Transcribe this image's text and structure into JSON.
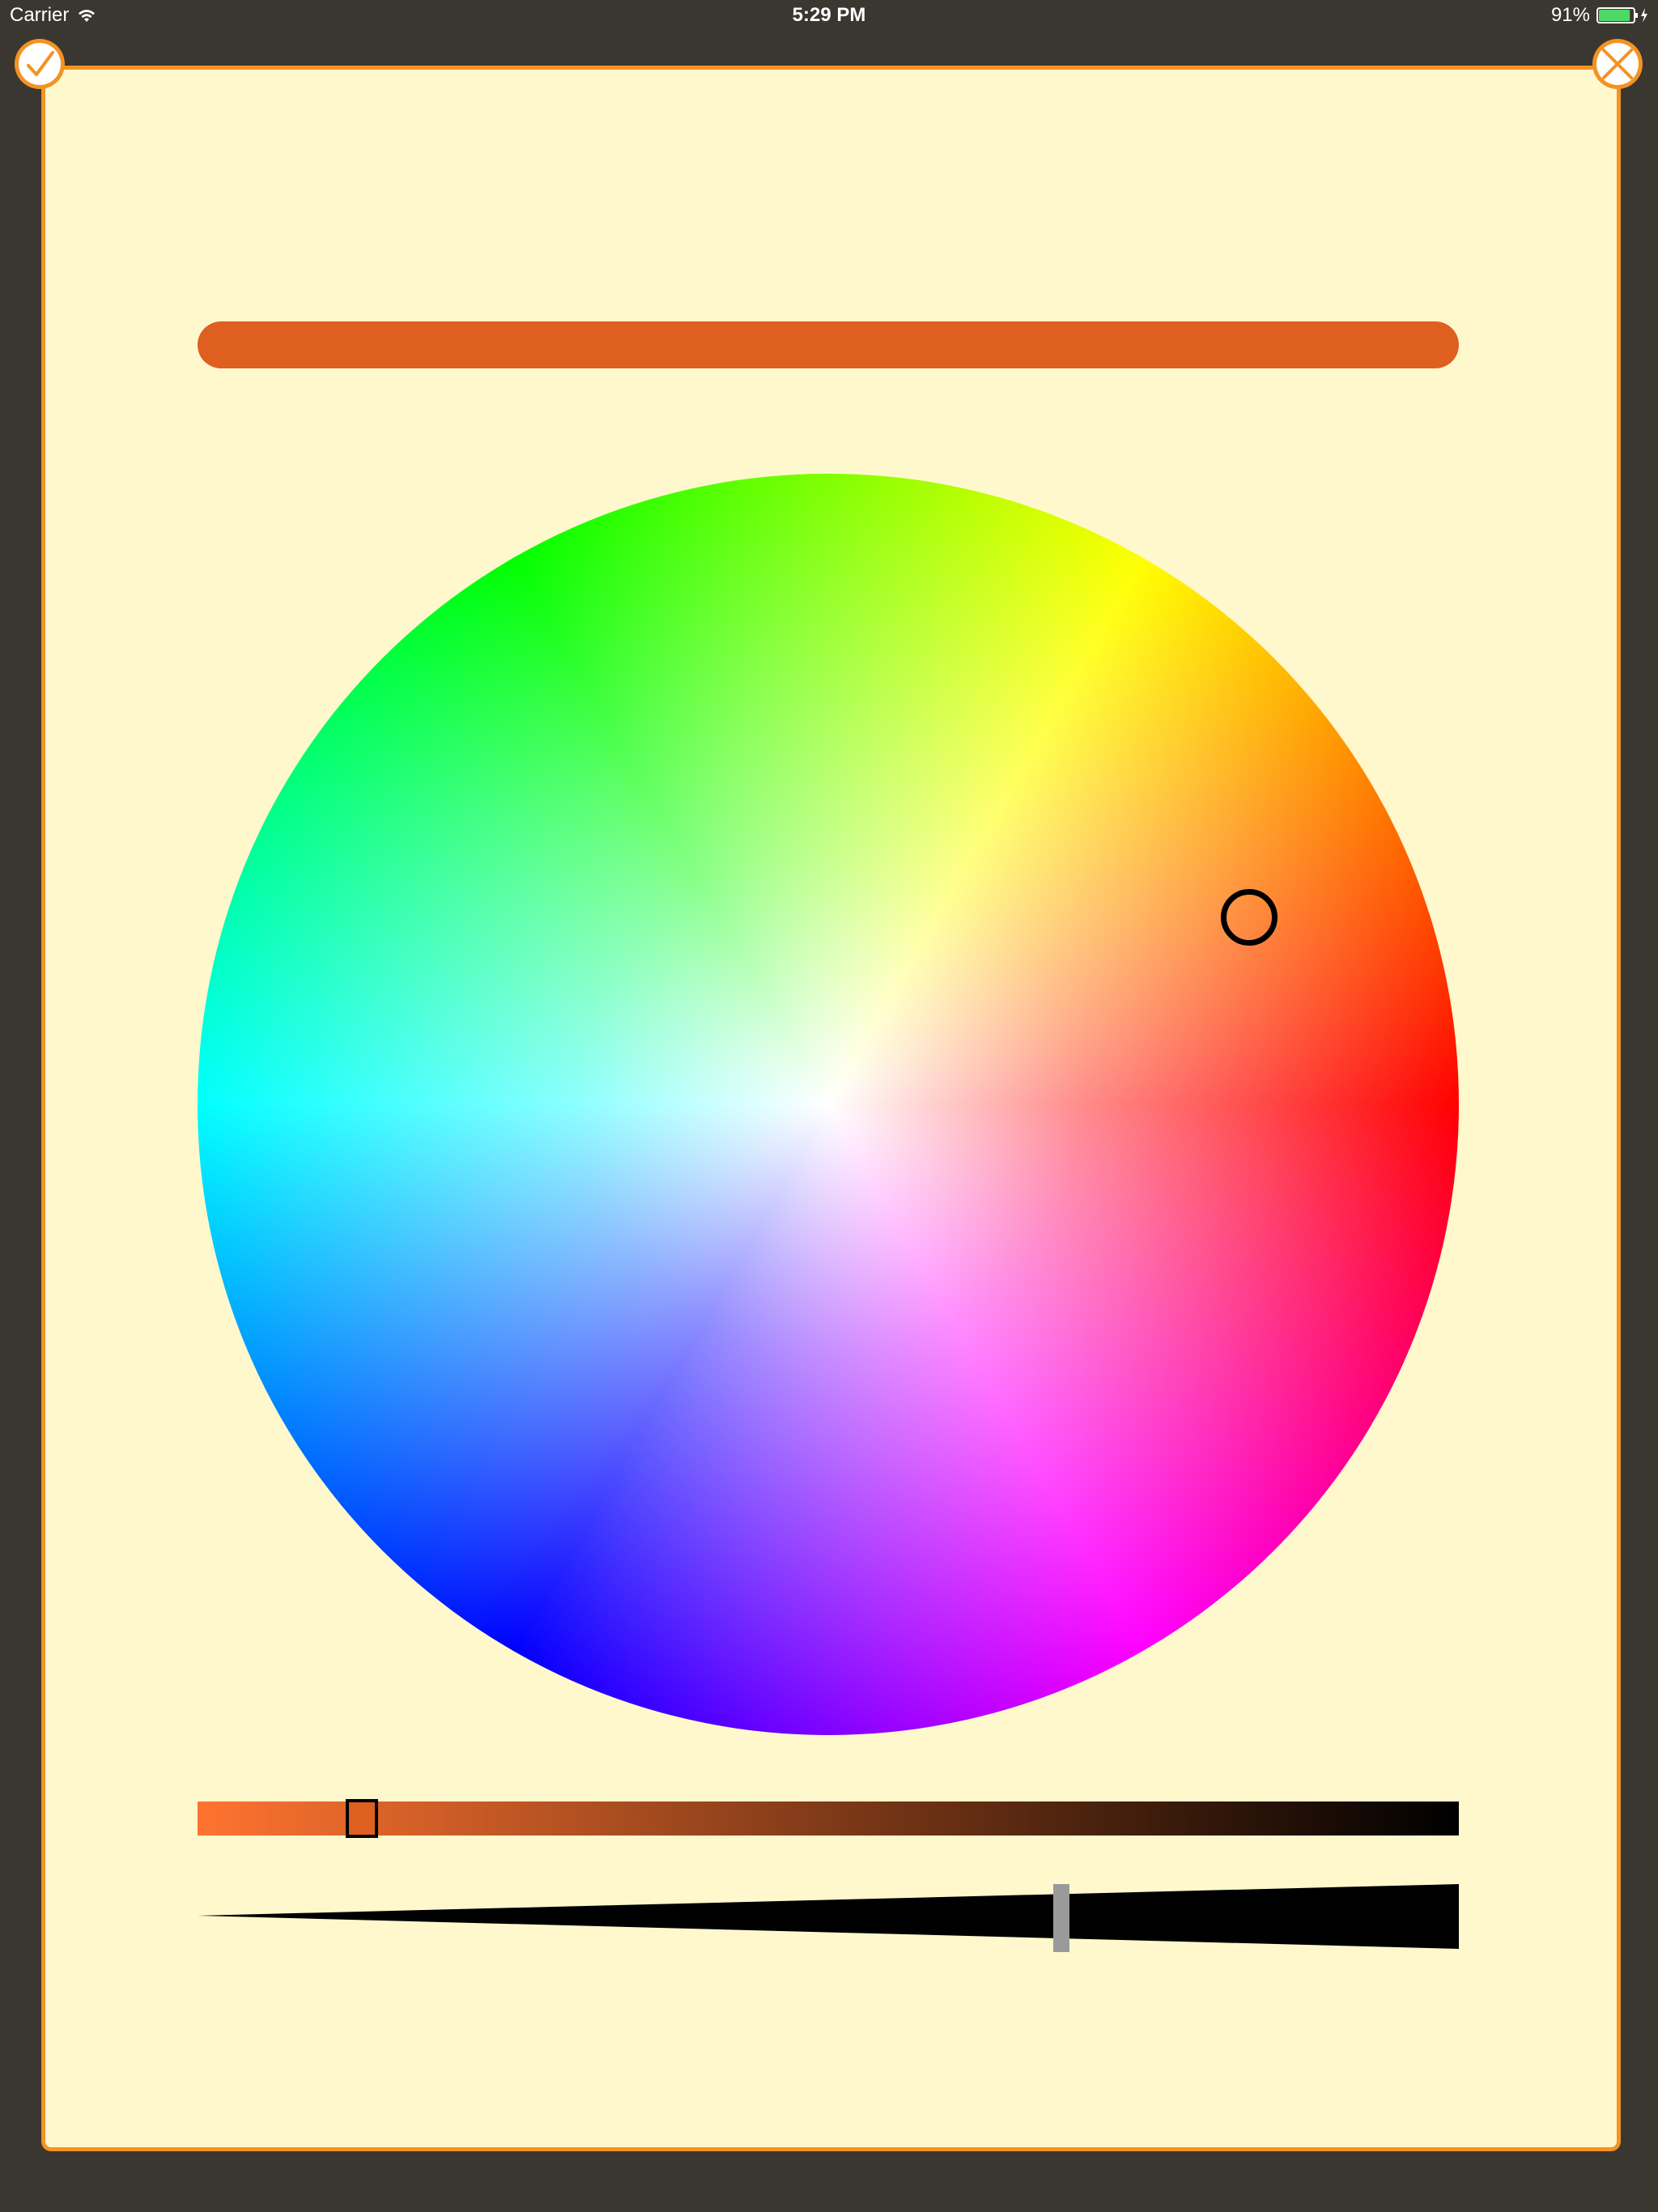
{
  "status_bar": {
    "carrier": "Carrier",
    "time": "5:29 PM",
    "battery_percent": "91%",
    "battery_level": 0.91,
    "icons": [
      "wifi-icon",
      "battery-icon",
      "charging-bolt-icon"
    ]
  },
  "toolbar": {
    "done_icon": "checkmark-icon",
    "close_icon": "close-x-icon"
  },
  "colors": {
    "accent": "#f39324",
    "panel_background": "#fff8cd",
    "backdrop": "#3a3730",
    "selected_color": "#de5f20",
    "brightness_start": "#ff7330",
    "brightness_end": "#000000"
  },
  "color_wheel": {
    "selected_hue_degrees": 24,
    "selected_saturation": 0.73
  },
  "brightness_slider": {
    "value": 0.13
  },
  "size_slider": {
    "value": 0.685
  }
}
